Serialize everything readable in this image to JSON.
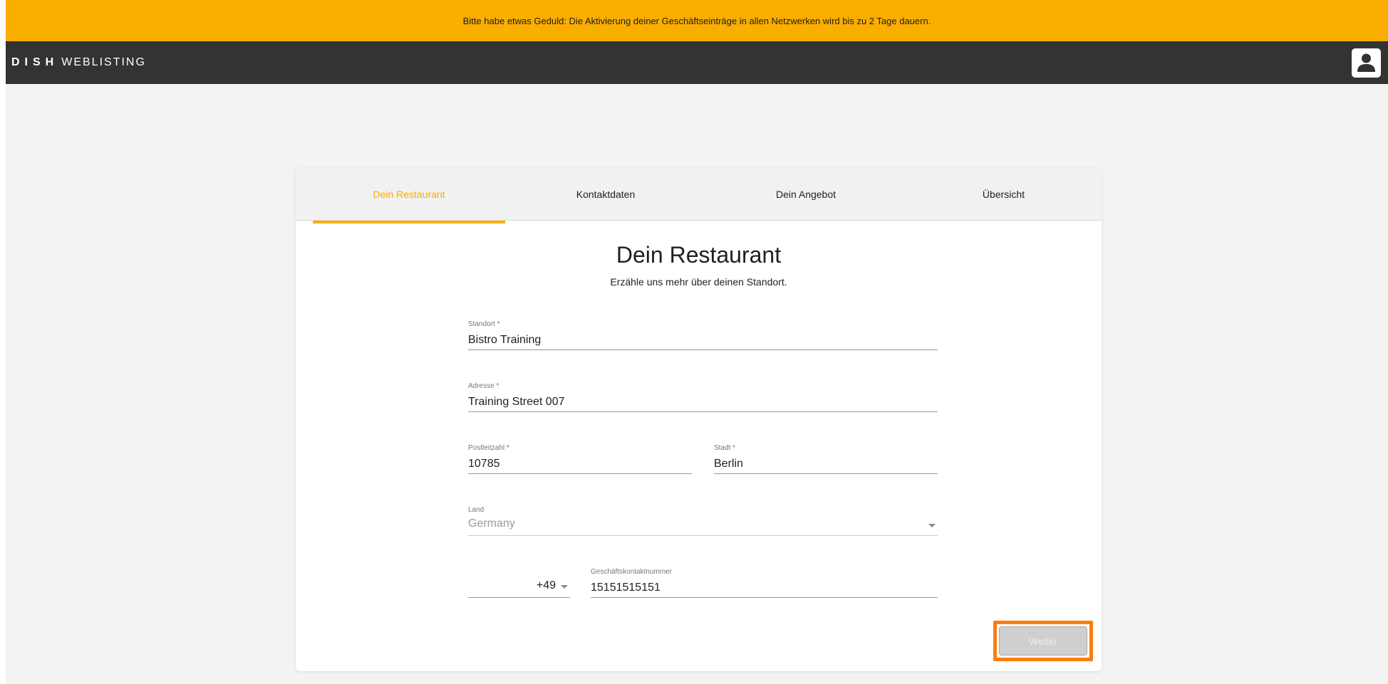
{
  "banner": {
    "text": "Bitte habe etwas Geduld: Die Aktivierung deiner Geschäftseinträge in allen Netzwerken wird bis zu 2 Tage dauern."
  },
  "header": {
    "logo_bold": "DISH",
    "logo_light": "WEBLISTING",
    "profile_icon": "user-icon"
  },
  "tabs": [
    {
      "label": "Dein Restaurant",
      "active": true
    },
    {
      "label": "Kontaktdaten",
      "active": false
    },
    {
      "label": "Dein Angebot",
      "active": false
    },
    {
      "label": "Übersicht",
      "active": false
    }
  ],
  "form": {
    "title": "Dein Restaurant",
    "subtitle": "Erzähle uns mehr über deinen Standort.",
    "standort": {
      "label": "Standort *",
      "value": "Bistro Training"
    },
    "adresse": {
      "label": "Adresse *",
      "value": "Training Street 007"
    },
    "postleitzahl": {
      "label": "Postleitzahl *",
      "value": "10785"
    },
    "stadt": {
      "label": "Stadt *",
      "value": "Berlin"
    },
    "land": {
      "label": "Land",
      "value": "Germany"
    },
    "phone": {
      "prefix": "+49",
      "label": "Geschäftskontaktnummer",
      "value": "15151515151"
    },
    "submit_label": "Weiter"
  },
  "colors": {
    "accent": "#f9ae00",
    "highlight": "#f97e0f",
    "topbar": "#333333"
  }
}
